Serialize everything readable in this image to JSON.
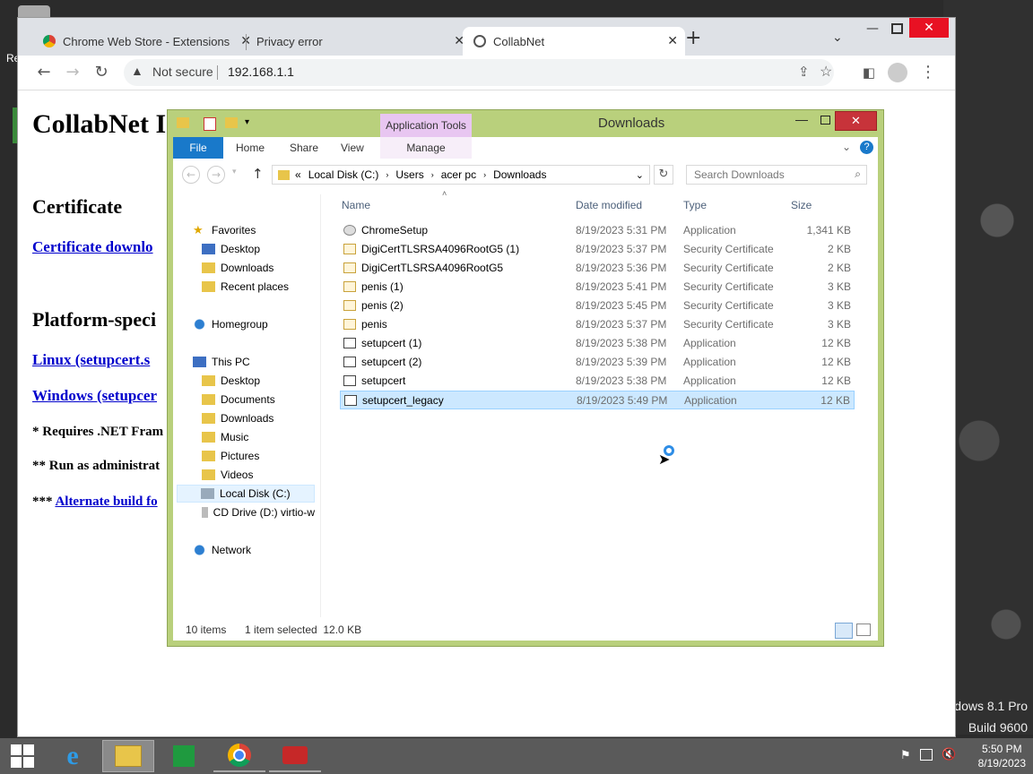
{
  "desktop": {
    "recycle_label": "Re",
    "watermark_line1": "dows 8.1 Pro",
    "watermark_line2": "Build 9600"
  },
  "browser": {
    "tabs": [
      {
        "label": "Chrome Web Store - Extensions",
        "icon": "chrome-web-store-icon"
      },
      {
        "label": "Privacy error",
        "icon": ""
      },
      {
        "label": "CollabNet",
        "icon": "globe-icon"
      }
    ],
    "security_label": "Not secure",
    "url": "192.168.1.1",
    "page": {
      "heading": "CollabNet I",
      "certificate_heading": "Certificate",
      "certificate_link": "Certificate downlo",
      "platform_heading": "Platform-speci",
      "linux_link": "Linux (setupcert.s",
      "windows_link": "Windows (setupcer",
      "note1": "* Requires .NET Fram",
      "note2": "** Run as administrat",
      "note3_prefix": "*** ",
      "note3_link": "Alternate build fo"
    }
  },
  "explorer": {
    "title": "Downloads",
    "context_tab": "Application Tools",
    "ribbon_tabs": {
      "file": "File",
      "home": "Home",
      "share": "Share",
      "view": "View",
      "manage": "Manage"
    },
    "breadcrumb": {
      "prefix": "«",
      "items": [
        "Local Disk (C:)",
        "Users",
        "acer pc",
        "Downloads"
      ]
    },
    "search_placeholder": "Search Downloads",
    "nav": {
      "favorites": "Favorites",
      "desktop": "Desktop",
      "downloads": "Downloads",
      "recent": "Recent places",
      "homegroup": "Homegroup",
      "thispc": "This PC",
      "pc_desktop": "Desktop",
      "documents": "Documents",
      "pc_downloads": "Downloads",
      "music": "Music",
      "pictures": "Pictures",
      "videos": "Videos",
      "localdisk": "Local Disk (C:)",
      "cddrive": "CD Drive (D:) virtio-w",
      "network": "Network"
    },
    "columns": {
      "name": "Name",
      "date": "Date modified",
      "type": "Type",
      "size": "Size"
    },
    "files": [
      {
        "name": "ChromeSetup",
        "date": "8/19/2023 5:31 PM",
        "type": "Application",
        "size": "1,341 KB",
        "icon": "chrome-setup-icon"
      },
      {
        "name": "DigiCertTLSRSA4096RootG5 (1)",
        "date": "8/19/2023 5:37 PM",
        "type": "Security Certificate",
        "size": "2 KB",
        "icon": "certificate-icon"
      },
      {
        "name": "DigiCertTLSRSA4096RootG5",
        "date": "8/19/2023 5:36 PM",
        "type": "Security Certificate",
        "size": "2 KB",
        "icon": "certificate-icon"
      },
      {
        "name": "penis (1)",
        "date": "8/19/2023 5:41 PM",
        "type": "Security Certificate",
        "size": "3 KB",
        "icon": "certificate-icon"
      },
      {
        "name": "penis (2)",
        "date": "8/19/2023 5:45 PM",
        "type": "Security Certificate",
        "size": "3 KB",
        "icon": "certificate-icon"
      },
      {
        "name": "penis",
        "date": "8/19/2023 5:37 PM",
        "type": "Security Certificate",
        "size": "3 KB",
        "icon": "certificate-icon"
      },
      {
        "name": "setupcert (1)",
        "date": "8/19/2023 5:38 PM",
        "type": "Application",
        "size": "12 KB",
        "icon": "application-icon"
      },
      {
        "name": "setupcert (2)",
        "date": "8/19/2023 5:39 PM",
        "type": "Application",
        "size": "12 KB",
        "icon": "application-icon"
      },
      {
        "name": "setupcert",
        "date": "8/19/2023 5:38 PM",
        "type": "Application",
        "size": "12 KB",
        "icon": "application-icon"
      },
      {
        "name": "setupcert_legacy",
        "date": "8/19/2023 5:49 PM",
        "type": "Application",
        "size": "12 KB",
        "icon": "application-icon"
      }
    ],
    "selected_file": "setupcert_legacy",
    "status_count": "10 items",
    "status_selected": "1 item selected  12.0 KB"
  },
  "taskbar": {
    "time": "5:50 PM",
    "date": "8/19/2023"
  },
  "colors": {
    "explorer_frame": "#b9d07c",
    "context_tab": "#e8c6f1",
    "file_tab": "#1979ca",
    "selection": "#cce8ff",
    "link": "#0000cc"
  }
}
